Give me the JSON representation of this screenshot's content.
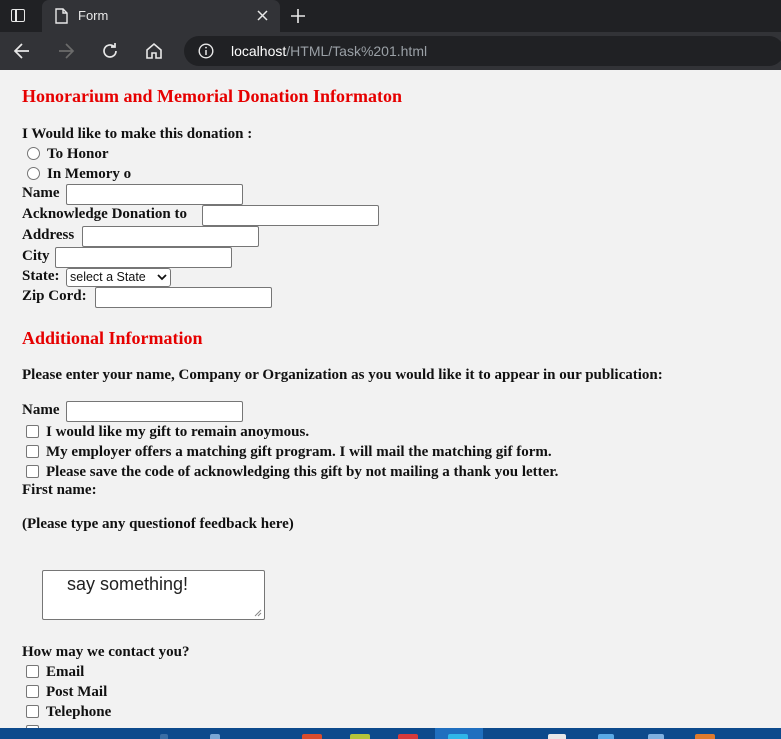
{
  "browser": {
    "tab_title": "Form",
    "url_host": "localhost",
    "url_path": "/HTML/Task%201.html"
  },
  "form": {
    "title": "Honorarium and Memorial Donation Informaton",
    "donation_prompt": "I Would like to make this donation :",
    "radio_options": [
      "To Honor",
      "In Memory o"
    ],
    "name_label": "Name",
    "acknowledge_label": "Acknowledge Donation to",
    "address_label": "Address",
    "city_label": "City",
    "state_label": "State:",
    "state_select_value": "select a State",
    "zip_label": "Zip Cord:"
  },
  "additional": {
    "title": "Additional Information",
    "instructions": "Please enter your name, Company or Organization as you would like it to appear in our publication:",
    "name_label": "Name",
    "checkboxes": [
      "I would like my gift to remain anoymous.",
      "My employer offers a matching gift program. I will mail the matching gif form.",
      "Please save the code of acknowledging this gift by not mailing a thank you letter."
    ],
    "first_name_label": "First name:",
    "feedback_prompt": "(Please type any questionof feedback here)",
    "textarea_placeholder": "say something!",
    "contact_prompt": "How may we contact you?",
    "contact_options": [
      "Email",
      "Post Mail",
      "Telephone"
    ]
  },
  "colors": {
    "heading_red": "#e60000",
    "page_bg": "#f2f2f2",
    "chrome_dark": "#202124",
    "taskbar_blue": "#0d4a8c"
  }
}
